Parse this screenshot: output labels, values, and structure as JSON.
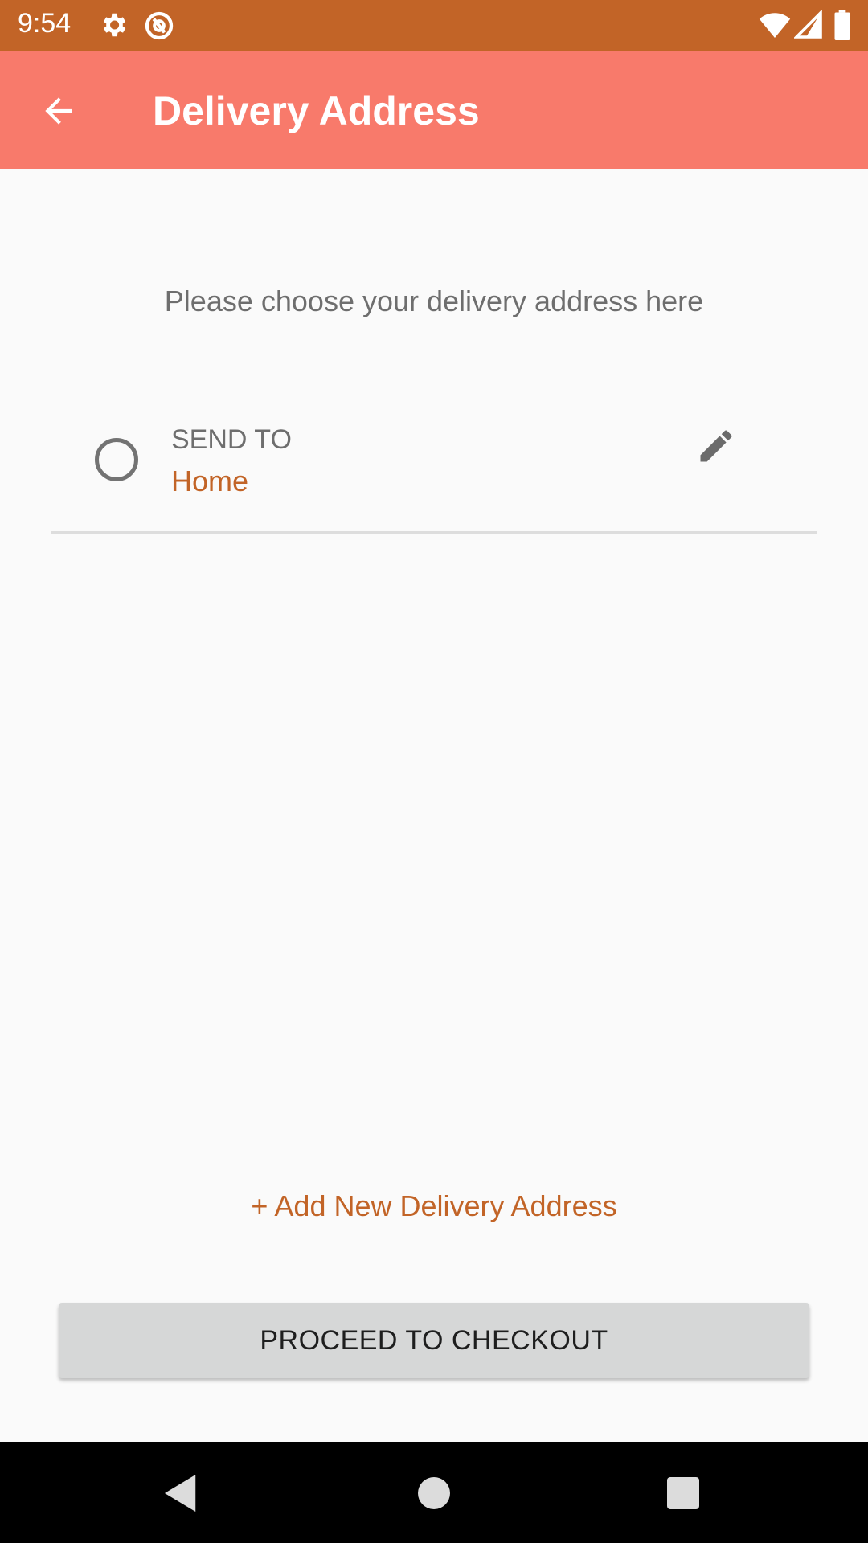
{
  "status_bar": {
    "time": "9:54",
    "icons": [
      "settings-icon",
      "app-notification-icon",
      "wifi-icon",
      "signal-icon",
      "battery-icon"
    ]
  },
  "app_bar": {
    "title": "Delivery Address",
    "back_icon": "arrow-back-icon",
    "background": "#f87a6b"
  },
  "main": {
    "subtitle": "Please choose your delivery address here",
    "addresses": [
      {
        "label": "SEND TO",
        "name": "Home",
        "selected": false,
        "edit_icon": "pencil-icon"
      }
    ],
    "add_address_label": "+ Add New Delivery Address",
    "checkout_label": "PROCEED TO CHECKOUT"
  },
  "nav_bar": {
    "buttons": [
      "back-triangle-icon",
      "home-circle-icon",
      "recents-square-icon"
    ]
  },
  "colors": {
    "status_bar": "#c26427",
    "accent": "#c26427",
    "button": "#d6d7d7"
  }
}
